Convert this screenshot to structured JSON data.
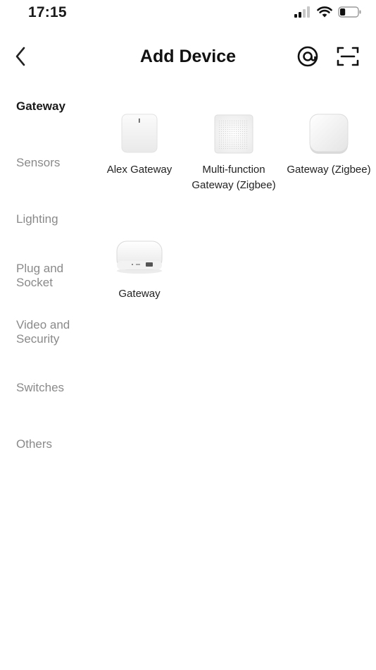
{
  "status_bar": {
    "time": "17:15",
    "battery_level": 0.3
  },
  "header": {
    "title": "Add Device",
    "back_icon": "chevron-left-icon",
    "radar_icon": "at-radar-icon",
    "scan_icon": "scan-qr-icon"
  },
  "categories": [
    {
      "label": "Gateway",
      "active": true
    },
    {
      "label": "Sensors"
    },
    {
      "label": "Lighting"
    },
    {
      "label": "Plug and Socket"
    },
    {
      "label": "Video and Security"
    },
    {
      "label": "Switches"
    },
    {
      "label": "Others"
    }
  ],
  "devices": [
    {
      "name": "Alex Gateway",
      "image": "white-square-hub"
    },
    {
      "name": "Multi-function Gateway (Zigbee)",
      "image": "speaker-grille-hub"
    },
    {
      "name": "Gateway (Zigbee)",
      "image": "white-rounded-hub"
    },
    {
      "name": "Gateway",
      "image": "flat-hub-with-port"
    }
  ],
  "colors": {
    "active_text": "#1a1a1a",
    "inactive_text": "#8a8a8a",
    "background": "#ffffff"
  }
}
